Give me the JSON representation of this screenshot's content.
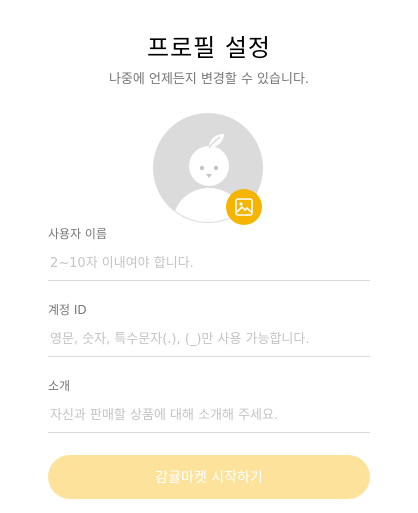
{
  "header": {
    "title": "프로필 설정",
    "subtitle": "나중에 언제든지 변경할 수 있습니다."
  },
  "avatar": {
    "icon": "default-profile-image",
    "upload_icon": "image-upload-icon"
  },
  "fields": [
    {
      "label": "사용자 이름",
      "value": "",
      "placeholder": "2~10자 이내여야 합니다."
    },
    {
      "label": "계정 ID",
      "value": "",
      "placeholder": "영문, 숫자, 특수문자(.), (_)만 사용 가능합니다."
    },
    {
      "label": "소개",
      "value": "",
      "placeholder": "자신과 판매할 상품에 대해 소개해 주세요."
    }
  ],
  "submit": {
    "label": "감귤마켓 시작하기"
  },
  "colors": {
    "accent": "#F5B400",
    "button_disabled": "#FCE29A",
    "label": "#767676",
    "placeholder": "#C4C4C4",
    "border": "#DBDBDB"
  }
}
